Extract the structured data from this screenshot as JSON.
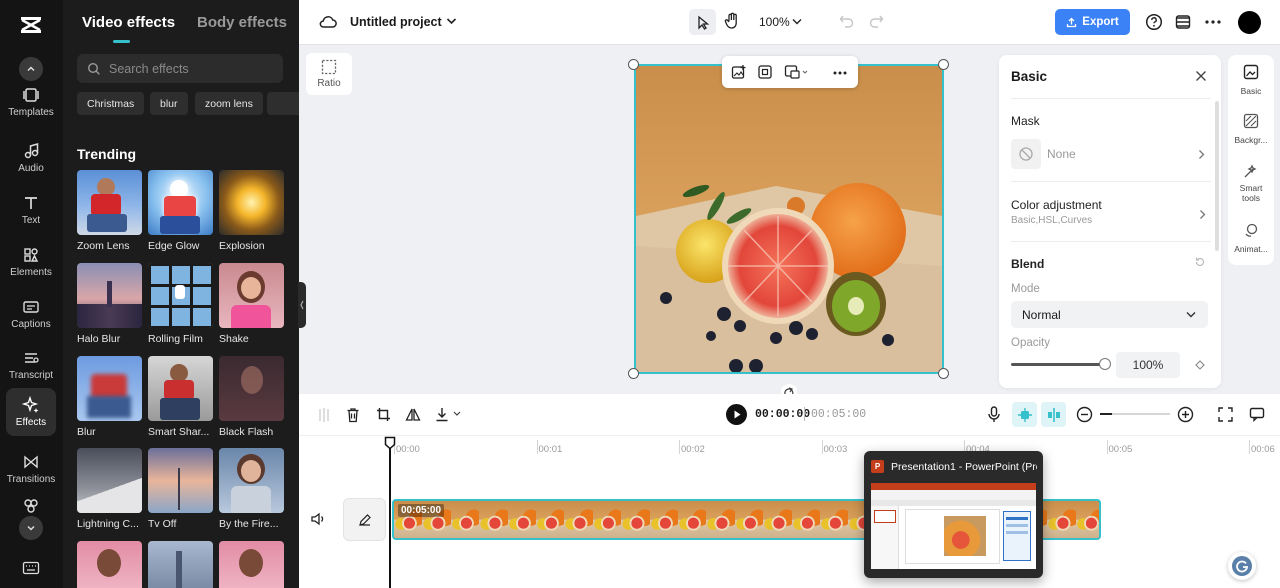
{
  "rail": {
    "items": [
      {
        "label": "Templates",
        "icon": "templates-icon"
      },
      {
        "label": "Audio",
        "icon": "music-note-icon"
      },
      {
        "label": "Text",
        "icon": "text-t-icon"
      },
      {
        "label": "Elements",
        "icon": "elements-icon"
      },
      {
        "label": "Captions",
        "icon": "captions-icon"
      },
      {
        "label": "Transcript",
        "icon": "transcript-icon"
      },
      {
        "label": "Effects",
        "icon": "sparkle-icon",
        "active": true
      },
      {
        "label": "Transitions",
        "icon": "transitions-icon"
      }
    ]
  },
  "effects_panel": {
    "tabs": [
      "Video effects",
      "Body effects"
    ],
    "active_tab": "Video effects",
    "search_placeholder": "Search effects",
    "chips": [
      "Christmas",
      "blur",
      "zoom lens"
    ],
    "section_title": "Trending",
    "effects": [
      "Zoom Lens",
      "Edge Glow",
      "Explosion",
      "Halo Blur",
      "Rolling Film",
      "Shake",
      "Blur",
      "Smart Shar...",
      "Black Flash",
      "Lightning C...",
      "Tv Off",
      "By the Fire..."
    ]
  },
  "topbar": {
    "project_title": "Untitled project",
    "zoom": "100%",
    "export_label": "Export"
  },
  "canvas": {
    "ratio_label": "Ratio"
  },
  "properties": {
    "title": "Basic",
    "mask_label": "Mask",
    "mask_value": "None",
    "color_adjustment_label": "Color adjustment",
    "color_adjustment_sub": "Basic,HSL,Curves",
    "blend_label": "Blend",
    "mode_label": "Mode",
    "mode_value": "Normal",
    "opacity_label": "Opacity",
    "opacity_value": "100%"
  },
  "side_tabs": [
    "Basic",
    "Backgr...",
    "Smart tools",
    "Animat..."
  ],
  "playback": {
    "current_time": "00:00:00",
    "total_time": "00:05:00"
  },
  "timeline": {
    "ticks": [
      "00:00",
      "00:01",
      "00:02",
      "00:03",
      "00:04",
      "00:05",
      "00:06"
    ],
    "clip_duration": "00:05:00"
  },
  "taskbar_preview": {
    "title": "Presentation1 - PowerPoint (Pro..."
  },
  "colors": {
    "accent": "#35c0cc",
    "export": "#3b82f6",
    "panel_bg": "#1c1c1c",
    "rail_bg": "#141414"
  }
}
